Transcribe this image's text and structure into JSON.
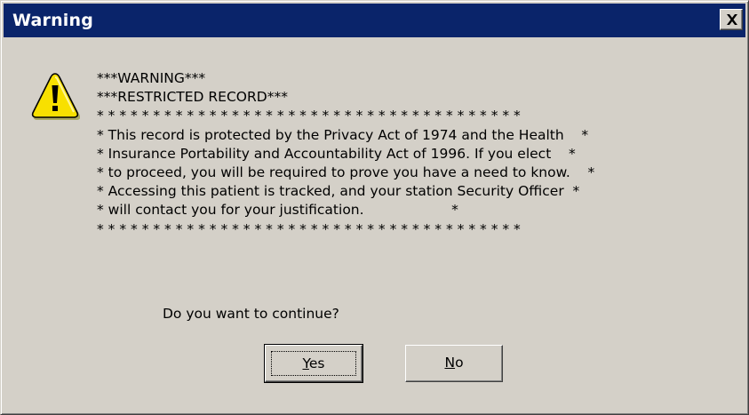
{
  "window": {
    "title": "Warning"
  },
  "icons": {
    "warning": "warning-triangle-icon",
    "close": "close-icon"
  },
  "message": {
    "lines": [
      "***WARNING***",
      "***RESTRICTED RECORD***",
      "* * * * * * * * * * * * * * * * * * * * * * * * * * * * * * * * * * * * * *",
      "* This record is protected by the Privacy Act of 1974 and the Health    *",
      "* Insurance Portability and Accountability Act of 1996. If you elect    *",
      "* to proceed, you will be required to prove you have a need to know.    *",
      "* Accessing this patient is tracked, and your station Security Officer  *",
      "* will contact you for your justification.                    *",
      "* * * * * * * * * * * * * * * * * * * * * * * * * * * * * * * * * * * * * *"
    ],
    "question": "Do you want to continue?"
  },
  "buttons": {
    "yes": {
      "mnemonic": "Y",
      "rest": "es"
    },
    "no": {
      "mnemonic": "N",
      "rest": "o"
    }
  },
  "colors": {
    "titlebar": "#0a246a",
    "face": "#d4d0c8",
    "icon_yellow": "#f8e000"
  }
}
